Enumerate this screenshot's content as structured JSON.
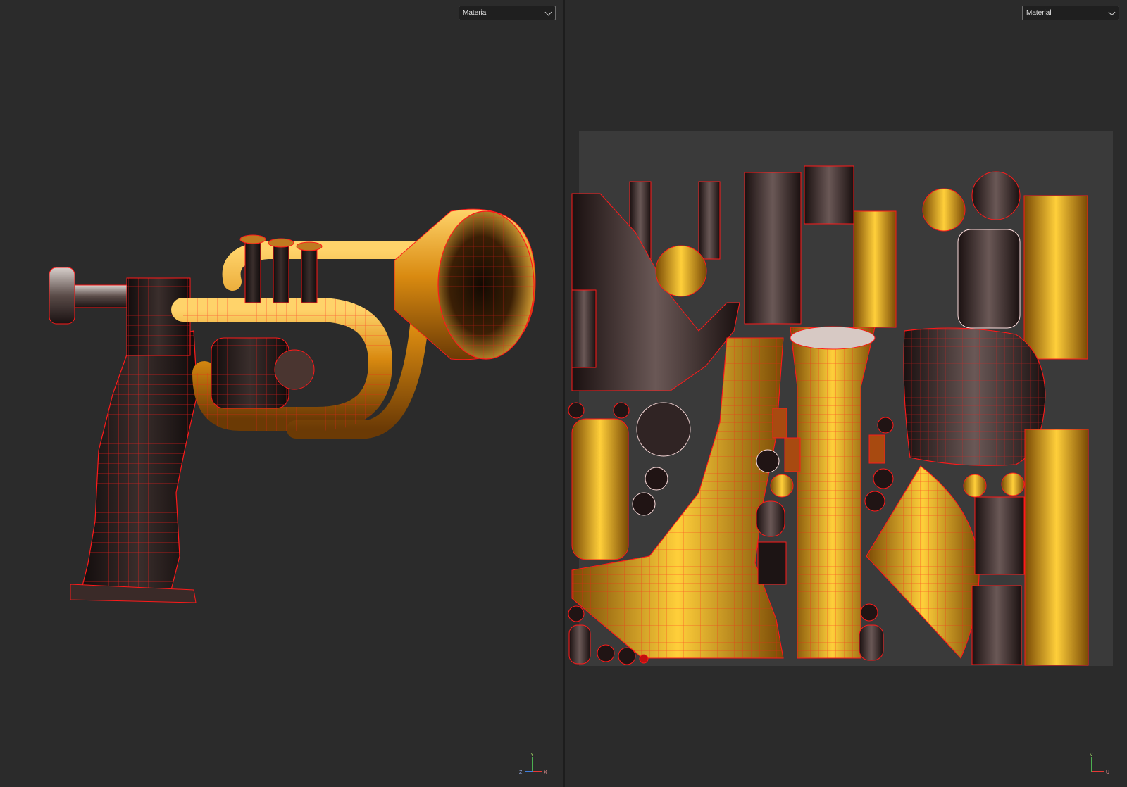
{
  "viewport_3d": {
    "display_mode": {
      "selected": "Material"
    },
    "axis_gizmo": {
      "labels": [
        "Y",
        "Z",
        "X"
      ]
    }
  },
  "viewport_uv": {
    "display_mode": {
      "selected": "Material"
    },
    "axis_gizmo": {
      "labels": [
        "V",
        "U"
      ]
    }
  },
  "colors": {
    "background": "#2b2b2b",
    "uv_tile": "#3a3a3a",
    "wire": "#ff1a1a",
    "gold": "#e8a317",
    "dark_metal": "#1a1414"
  }
}
